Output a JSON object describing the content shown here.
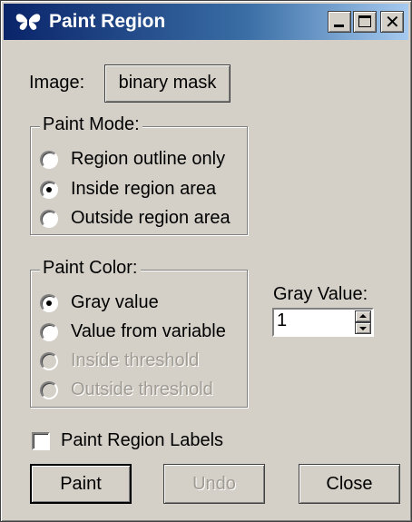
{
  "window": {
    "title": "Paint Region",
    "icon": "app-butterfly-icon",
    "controls": {
      "minimize": "minimize-icon",
      "maximize": "maximize-icon",
      "close": "close-icon",
      "close_glyph": "✕"
    }
  },
  "image": {
    "label": "Image:",
    "button_label": "binary mask"
  },
  "paint_mode": {
    "title": "Paint Mode:",
    "options": [
      {
        "label": "Region outline only",
        "selected": false,
        "enabled": true
      },
      {
        "label": "Inside region area",
        "selected": true,
        "enabled": true
      },
      {
        "label": "Outside region area",
        "selected": false,
        "enabled": true
      }
    ]
  },
  "paint_color": {
    "title": "Paint Color:",
    "options": [
      {
        "label": "Gray value",
        "selected": true,
        "enabled": true
      },
      {
        "label": "Value from variable",
        "selected": false,
        "enabled": true
      },
      {
        "label": "Inside threshold",
        "selected": false,
        "enabled": false
      },
      {
        "label": "Outside threshold",
        "selected": false,
        "enabled": false
      }
    ]
  },
  "gray_value": {
    "label": "Gray Value:",
    "value": "1"
  },
  "paint_region_labels": {
    "label": "Paint Region Labels",
    "checked": false
  },
  "buttons": {
    "paint": "Paint",
    "undo": "Undo",
    "close": "Close"
  },
  "colors": {
    "titlebar_start": "#0a246a",
    "titlebar_end": "#a6caf0",
    "face": "#d4d0c8",
    "disabled_text": "#a09c94"
  }
}
